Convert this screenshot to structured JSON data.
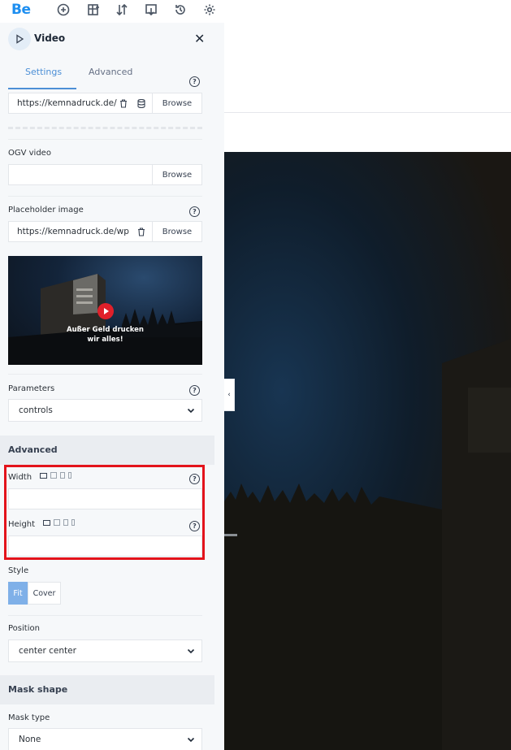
{
  "topbar": {
    "logo": "Be",
    "icons": [
      "add-circle-icon",
      "grid-add-icon",
      "sort-icon",
      "export-icon",
      "history-icon",
      "gear-icon"
    ]
  },
  "panel": {
    "title": "Video",
    "tabs": [
      {
        "label": "Settings",
        "active": true
      },
      {
        "label": "Advanced",
        "active": false
      }
    ],
    "fields": {
      "mp4_url": "https://kemnadruck.de/",
      "browse_label": "Browse",
      "ogv_label": "OGV video",
      "ogv_value": "",
      "placeholder_label": "Placeholder image",
      "placeholder_value": "https://kemnadruck.de/wp",
      "preview_caption_line1": "Außer Geld drucken",
      "preview_caption_line2": "wir alles!",
      "parameters_label": "Parameters",
      "parameters_value": "controls"
    },
    "advanced": {
      "heading": "Advanced",
      "width_label": "Width",
      "width_value": "",
      "height_label": "Height",
      "height_value": "",
      "style_label": "Style",
      "style_options": [
        "Fit",
        "Cover"
      ],
      "style_selected": "Fit",
      "position_label": "Position",
      "position_value": "center center"
    },
    "mask": {
      "heading": "Mask shape",
      "type_label": "Mask type",
      "type_value": "None"
    }
  },
  "colors": {
    "accent": "#4c8fd6",
    "highlight": "#e3131b",
    "panel_bg": "#f6f8fa"
  }
}
